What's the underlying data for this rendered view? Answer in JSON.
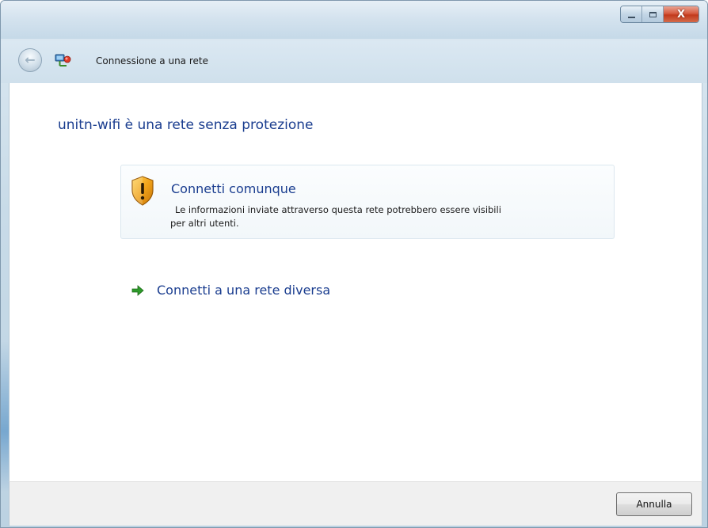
{
  "window": {
    "title": "Connessione a una rete"
  },
  "caption": {
    "minimize_icon": "minimize-icon",
    "maximize_icon": "maximize-icon",
    "close_label": "X"
  },
  "content": {
    "heading": "unitn-wifi è una rete senza protezione",
    "option": {
      "title": "Connetti comunque",
      "desc_line1": "Le informazioni inviate attraverso questa rete potrebbero essere visibili",
      "desc_line2": "per altri utenti.",
      "icon": "warning-shield-icon"
    },
    "alt_link": {
      "label": "Connetti a una rete diversa",
      "icon": "green-arrow-icon"
    }
  },
  "footer": {
    "cancel_label": "Annulla"
  },
  "colors": {
    "link_blue": "#1a3d8f",
    "arrow_green": "#2e9a2a",
    "shield_orange": "#f0a21a",
    "close_red": "#c23a1c"
  }
}
